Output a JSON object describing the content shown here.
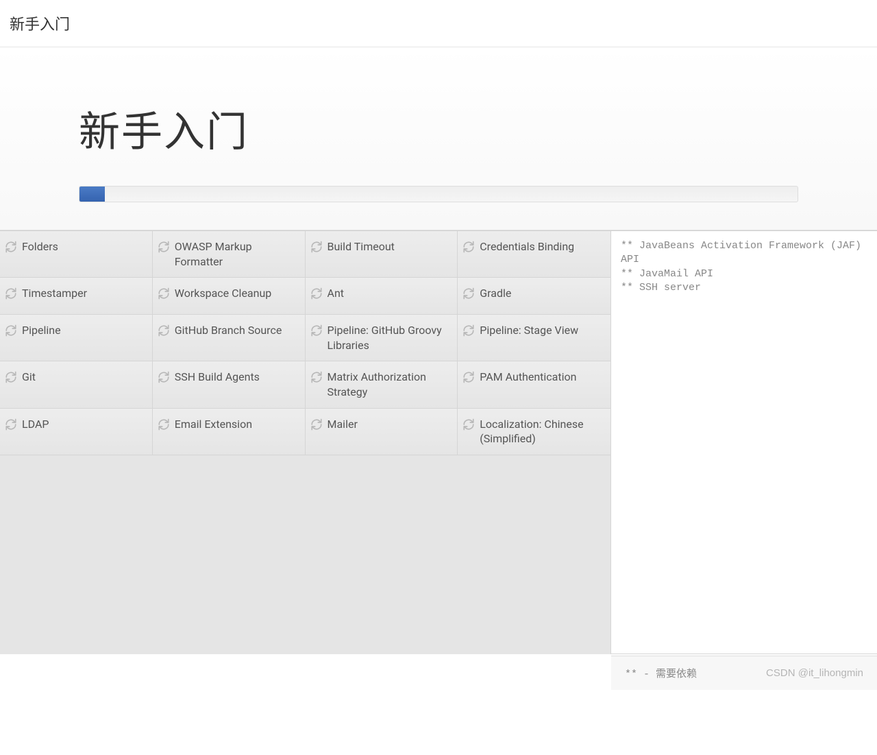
{
  "header": {
    "title": "新手入门"
  },
  "hero": {
    "title": "新手入门",
    "progress_percent": 3.5
  },
  "plugins": [
    {
      "name": "Folders"
    },
    {
      "name": "OWASP Markup Formatter"
    },
    {
      "name": "Build Timeout"
    },
    {
      "name": "Credentials Binding"
    },
    {
      "name": "Timestamper"
    },
    {
      "name": "Workspace Cleanup"
    },
    {
      "name": "Ant"
    },
    {
      "name": "Gradle"
    },
    {
      "name": "Pipeline"
    },
    {
      "name": "GitHub Branch Source"
    },
    {
      "name": "Pipeline: GitHub Groovy Libraries"
    },
    {
      "name": "Pipeline: Stage View"
    },
    {
      "name": "Git"
    },
    {
      "name": "SSH Build Agents"
    },
    {
      "name": "Matrix Authorization Strategy"
    },
    {
      "name": "PAM Authentication"
    },
    {
      "name": "LDAP"
    },
    {
      "name": "Email Extension"
    },
    {
      "name": "Mailer"
    },
    {
      "name": "Localization: Chinese (Simplified)"
    }
  ],
  "side_log": [
    "** JavaBeans Activation Framework (JAF) API",
    "** JavaMail API",
    "** SSH server"
  ],
  "footer": {
    "left": "** - 需要依赖",
    "right": "CSDN @it_lihongmin"
  }
}
